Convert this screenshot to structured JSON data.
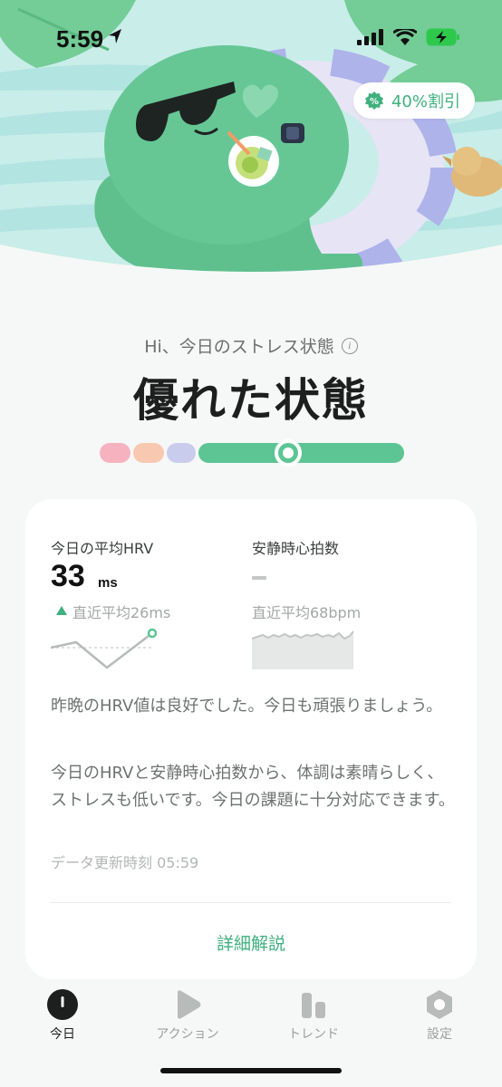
{
  "status_bar": {
    "time": "5:59",
    "icons": [
      "location-arrow-icon",
      "signal-bars-icon",
      "wifi-icon",
      "battery-charging-icon"
    ]
  },
  "promo": {
    "label": "40%割引",
    "icon": "discount-badge-icon"
  },
  "summary": {
    "greeting": "Hi、今日のストレス状態",
    "state": "優れた状態",
    "gauge_level": "excellent",
    "colors": {
      "accent": "#3fb07e",
      "gauge_pink": "#f6b3bf",
      "gauge_peach": "#f9c8b0",
      "gauge_lavender": "#c9ccec",
      "gauge_green": "#5cc593"
    }
  },
  "metrics": {
    "hrv": {
      "label": "今日の平均HRV",
      "value": "33",
      "unit": "ms",
      "trend": "up",
      "recent_avg": "直近平均26ms"
    },
    "resting_hr": {
      "label": "安静時心拍数",
      "value": "-",
      "recent_avg": "直近平均68bpm"
    }
  },
  "insight": {
    "headline": "昨晩のHRV値は良好でした。今日も頑張りましょう。",
    "body": "今日のHRVと安静時心拍数から、体調は素晴らしく、ストレスも低いです。今日の課題に十分対応できます。",
    "updated": "データ更新時刻 05:59",
    "detail_link": "詳細解説"
  },
  "tabbar": {
    "tabs": [
      {
        "label": "今日",
        "icon": "today-icon",
        "active": true
      },
      {
        "label": "アクション",
        "icon": "play-icon",
        "active": false
      },
      {
        "label": "トレンド",
        "icon": "bar-chart-icon",
        "active": false
      },
      {
        "label": "設定",
        "icon": "settings-hex-icon",
        "active": false
      }
    ]
  }
}
